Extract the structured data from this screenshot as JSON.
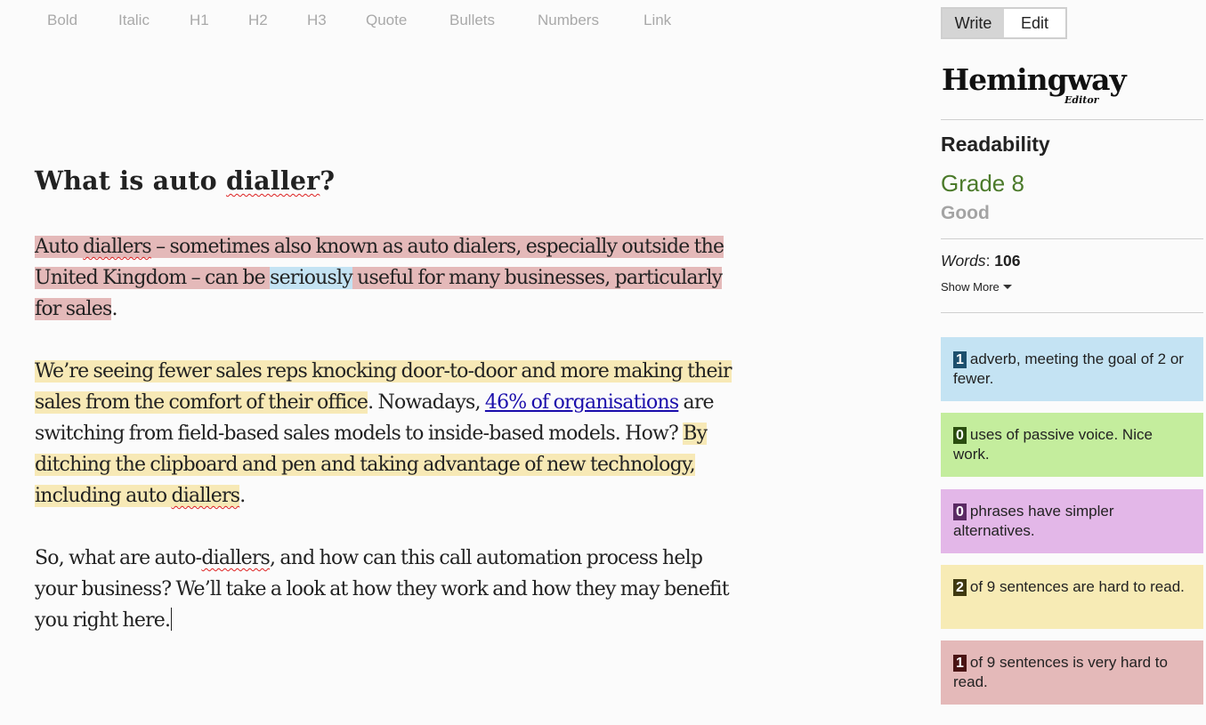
{
  "toolbar": {
    "items": [
      {
        "label": "Bold",
        "icon": "bold-icon"
      },
      {
        "label": "Italic",
        "icon": "italic-icon"
      },
      {
        "label": "H1",
        "icon": "h1-icon"
      },
      {
        "label": "H2",
        "icon": "h2-icon"
      },
      {
        "label": "H3",
        "icon": "h3-icon"
      },
      {
        "label": "Quote",
        "icon": "quote-icon"
      },
      {
        "label": "Bullets",
        "icon": "bullets-icon"
      },
      {
        "label": "Numbers",
        "icon": "numbers-icon"
      },
      {
        "label": "Link",
        "icon": "link-icon"
      }
    ]
  },
  "mode": {
    "write": "Write",
    "edit": "Edit",
    "active": "Write"
  },
  "logo": {
    "title": "Hemingway",
    "subtitle": "Editor"
  },
  "editor": {
    "heading": {
      "t1": "What is auto ",
      "spell": "dialler",
      "t2": "?"
    },
    "p1": {
      "s1a": "Auto ",
      "s1spell": "diallers",
      "s1b": " – sometimes also known as auto dialers, especially outside the United Kingdom – can be ",
      "adverb": "seriously",
      "s1c": " useful for many businesses, particularly for sales",
      "end": "."
    },
    "p2": {
      "hard1": "We’re seeing fewer sales reps knocking door-to-door and more making their sales from the comfort of their office",
      "t1": ". Nowadays, ",
      "link": "46% of organisations",
      "t2": " are switching from field-based sales models to inside-based models. How? ",
      "hard2a": "By ditching the clipboard and pen and taking advantage of new technology, including auto ",
      "hard2spell": "diallers",
      "end": "."
    },
    "p3": {
      "t1": "So, what are auto-",
      "spell": "diallers",
      "t2": ", and how can this call automation process help your business? We’ll take a look at how they work and how they may benefit you right here."
    }
  },
  "sidebar": {
    "readability_label": "Readability",
    "grade": "Grade 8",
    "rating": "Good",
    "words_label": "Words",
    "words_sep": ": ",
    "words_value": "106",
    "show_more": "Show More",
    "cards": [
      {
        "count": "1",
        "text": "adverb, meeting the goal of 2 or fewer.",
        "bg": "#c4e3f3",
        "badge": "#1c4f6d"
      },
      {
        "count": "0",
        "text": "uses of passive voice. Nice work.",
        "bg": "#c4ed9d",
        "badge": "#2a4d0f"
      },
      {
        "count": "0",
        "text": "phrases have simpler alternatives.",
        "bg": "#e3b7e8",
        "badge": "#5a2a63"
      },
      {
        "count": "2",
        "text": "of 9 sentences are hard to read.",
        "bg": "#f7ebb5",
        "badge": "#3f3910"
      },
      {
        "count": "1",
        "text": "of 9 sentences is very hard to read.",
        "bg": "#e4b9b9",
        "badge": "#4a1414"
      }
    ]
  }
}
